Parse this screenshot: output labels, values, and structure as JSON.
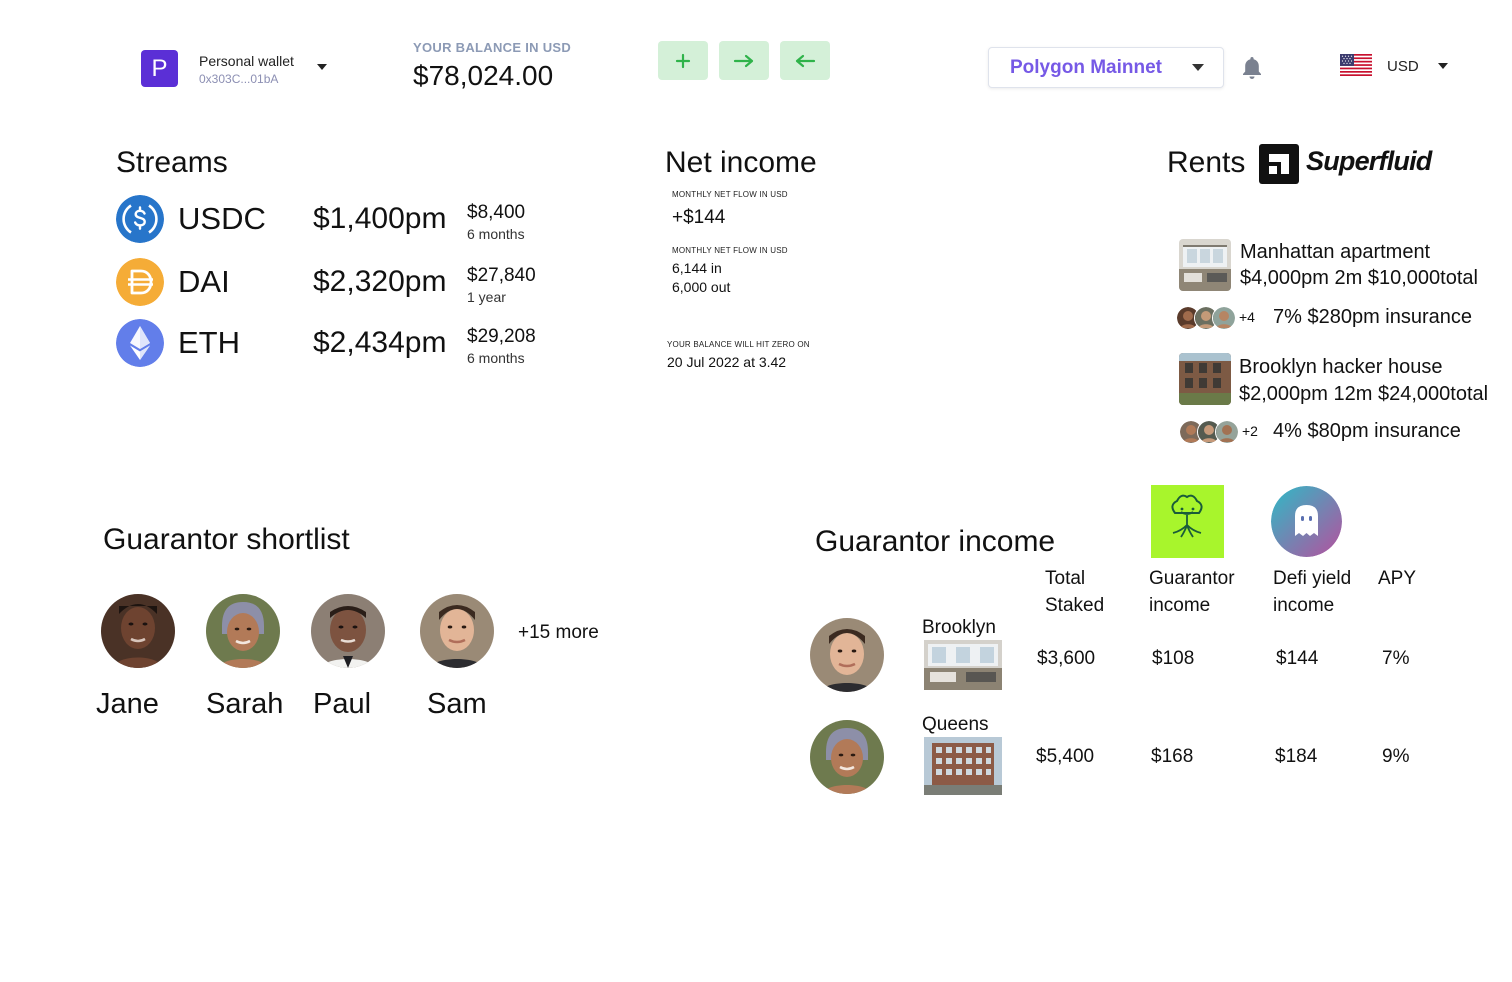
{
  "header": {
    "wallet": {
      "badge_letter": "P",
      "name": "Personal wallet",
      "address": "0x303C...01bA"
    },
    "balance": {
      "label": "YOUR BALANCE IN USD",
      "value": "$78,024.00"
    },
    "actions": [
      {
        "icon": "plus-icon",
        "symbol": "+"
      },
      {
        "icon": "arrow-right-icon",
        "symbol": "→"
      },
      {
        "icon": "arrow-left-icon",
        "symbol": "←"
      }
    ],
    "network": "Polygon Mainnet",
    "currency": "USD",
    "accent_color": "#7659e6",
    "action_bg": "#d4f0d8",
    "action_fg": "#2fb34a"
  },
  "streams": {
    "heading": "Streams",
    "items": [
      {
        "symbol": "USDC",
        "rate": "$1,400pm",
        "total": "$8,400",
        "period": "6 months",
        "color": "#2775ca"
      },
      {
        "symbol": "DAI",
        "rate": "$2,320pm",
        "total": "$27,840",
        "period": "1 year",
        "color": "#f5ac37"
      },
      {
        "symbol": "ETH",
        "rate": "$2,434pm",
        "total": "$29,208",
        "period": "6 months",
        "color": "#627eea"
      }
    ]
  },
  "net_income": {
    "heading": "Net income",
    "flow_label_1": "MONTHLY NET FLOW IN USD",
    "flow_value": "+$144",
    "flow_label_2": "MONTHLY NET FLOW IN USD",
    "flow_in": "6,144 in",
    "flow_out": "6,000 out",
    "zero_label": "YOUR BALANCE WILL HIT ZERO ON",
    "zero_date": "20 Jul 2022 at 3.42"
  },
  "rents": {
    "heading": "Rents",
    "brand": "Superfluid",
    "items": [
      {
        "title": "Manhattan apartment",
        "line": "$4,000pm 2m $10,000total",
        "extra_count": "+4",
        "insurance": "7% $280pm insurance"
      },
      {
        "title": "Brooklyn hacker house",
        "line": "$2,000pm 12m $24,000total",
        "extra_count": "+2",
        "insurance": "4% $80pm insurance"
      }
    ]
  },
  "guarantor_shortlist": {
    "heading": "Guarantor shortlist",
    "people": [
      {
        "name": "Jane"
      },
      {
        "name": "Sarah"
      },
      {
        "name": "Paul"
      },
      {
        "name": "Sam"
      }
    ],
    "more": "+15 more"
  },
  "guarantor_income": {
    "heading": "Guarantor income",
    "columns": {
      "total_staked": [
        "Total",
        "Staked"
      ],
      "guarantor_income": [
        "Guarantor",
        "income"
      ],
      "defi_yield": [
        "Defi yield",
        "income"
      ],
      "apy": "APY"
    },
    "rows": [
      {
        "property": "Brooklyn",
        "total_staked": "$3,600",
        "guarantor_income": "$108",
        "defi_yield": "$144",
        "apy": "7%"
      },
      {
        "property": "Queens",
        "total_staked": "$5,400",
        "guarantor_income": "$168",
        "defi_yield": "$184",
        "apy": "9%"
      }
    ]
  }
}
